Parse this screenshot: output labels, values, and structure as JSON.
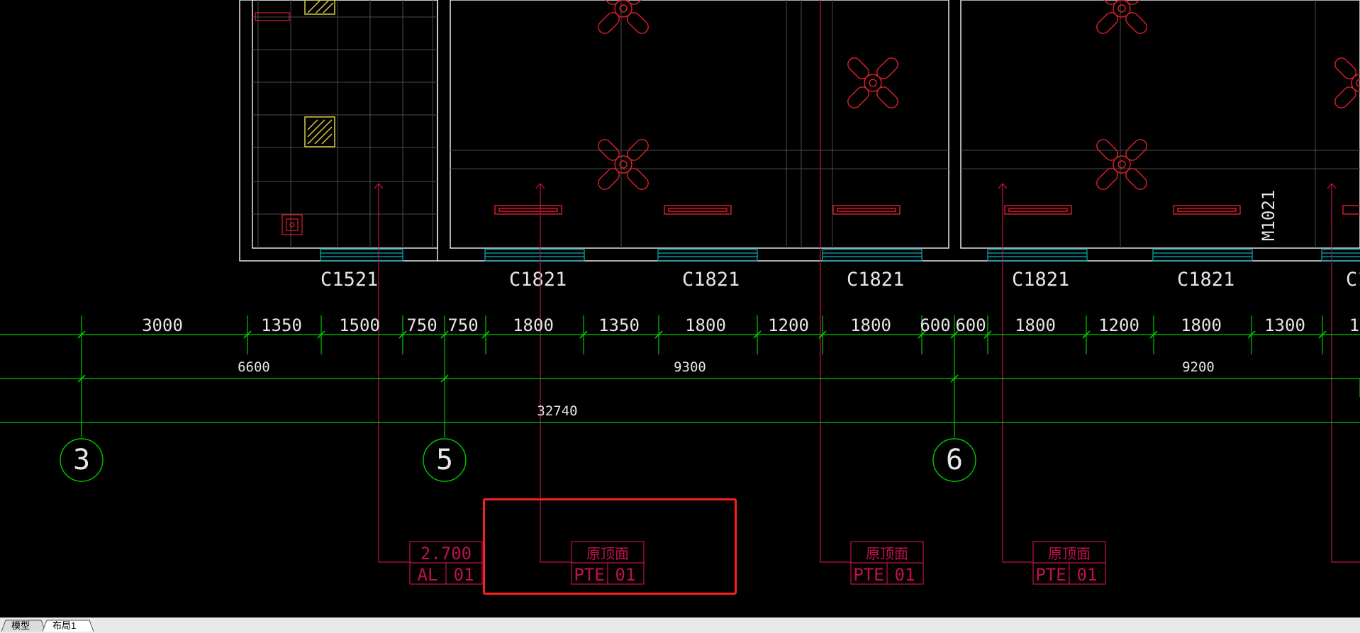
{
  "colors": {
    "background": "#000000",
    "wall": "#e6e6e6",
    "grid_fine": "#4a4a4a",
    "dimension": "#00c800",
    "axis_bubble": "#00c800",
    "fixture_red": "#e0202a",
    "window_cyan": "#00b4c0",
    "leader": "#c4104a",
    "tag_box": "#c4104a",
    "hatch_yellow": "#d8d040",
    "highlight": "#ff1e1e"
  },
  "windows": [
    "C1521",
    "C1821",
    "C1821",
    "C1821",
    "C1821",
    "C1821",
    "C1"
  ],
  "door_label": "M1021",
  "dimensions": {
    "row1": [
      "3000",
      "1350",
      "1500",
      "750",
      "750",
      "1800",
      "1350",
      "1800",
      "1200",
      "1800",
      "600",
      "600",
      "1800",
      "1200",
      "1800",
      "1300",
      "1"
    ],
    "row2": [
      "6600",
      "9300",
      "9200"
    ],
    "row3": [
      "32740"
    ]
  },
  "axes": [
    "3",
    "5",
    "6"
  ],
  "tags": [
    {
      "top": "2.700",
      "bottom_left": "AL",
      "bottom_right": "01"
    },
    {
      "top": "原顶面",
      "bottom_left": "PTE",
      "bottom_right": "01"
    },
    {
      "top": "原顶面",
      "bottom_left": "PTE",
      "bottom_right": "01"
    },
    {
      "top": "原顶面",
      "bottom_left": "PTE",
      "bottom_right": "01"
    }
  ],
  "tabs": [
    {
      "label": "模型",
      "active": false
    },
    {
      "label": "布局1",
      "active": true
    }
  ]
}
